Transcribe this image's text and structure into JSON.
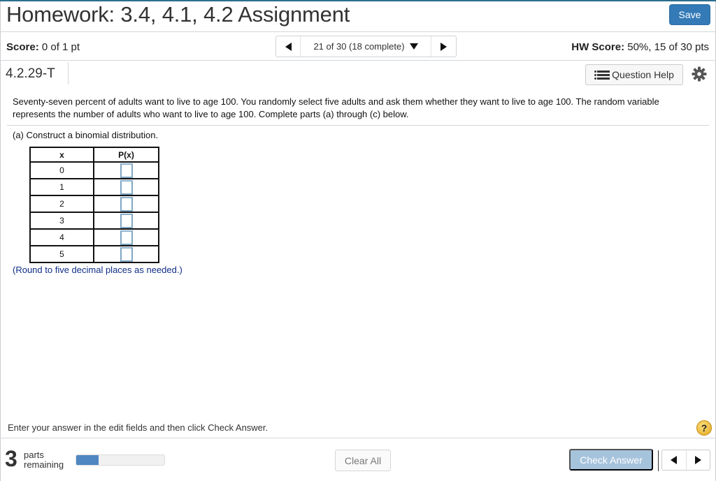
{
  "header": {
    "title": "Homework: 3.4, 4.1, 4.2 Assignment",
    "save_label": "Save"
  },
  "status": {
    "score_label": "Score:",
    "score_value": "0 of 1 pt",
    "nav_position": "21 of 30 (18 complete)",
    "hw_score_label": "HW Score:",
    "hw_score_value": "50%, 15 of 30 pts"
  },
  "question_bar": {
    "question_id": "4.2.29-T",
    "help_label": "Question Help"
  },
  "question": {
    "text": "Seventy-seven percent of adults want to live to age 100. You randomly select five adults and ask them whether they want to live to age 100. The random variable represents the number of adults who want to live to age 100. Complete parts (a) through (c) below.",
    "part_a": "(a) Construct a binomial distribution.",
    "table": {
      "headers": [
        "x",
        "P(x)"
      ],
      "rows": [
        {
          "x": "0",
          "p": ""
        },
        {
          "x": "1",
          "p": ""
        },
        {
          "x": "2",
          "p": ""
        },
        {
          "x": "3",
          "p": ""
        },
        {
          "x": "4",
          "p": ""
        },
        {
          "x": "5",
          "p": ""
        }
      ]
    },
    "round_note": "(Round to five decimal places as needed.)"
  },
  "footer": {
    "instruction": "Enter your answer in the edit fields and then click Check Answer.",
    "help_glyph": "?",
    "parts_remaining_count": "3",
    "parts_remaining_label_1": "parts",
    "parts_remaining_label_2": "remaining",
    "progress_fraction": 0.25,
    "clear_all_label": "Clear All",
    "check_answer_label": "Check Answer"
  },
  "colors": {
    "primary": "#337ab7",
    "check_disabled": "#a6c3dc",
    "progress_fill": "#4f87c0",
    "note_text": "#0f2d86"
  }
}
